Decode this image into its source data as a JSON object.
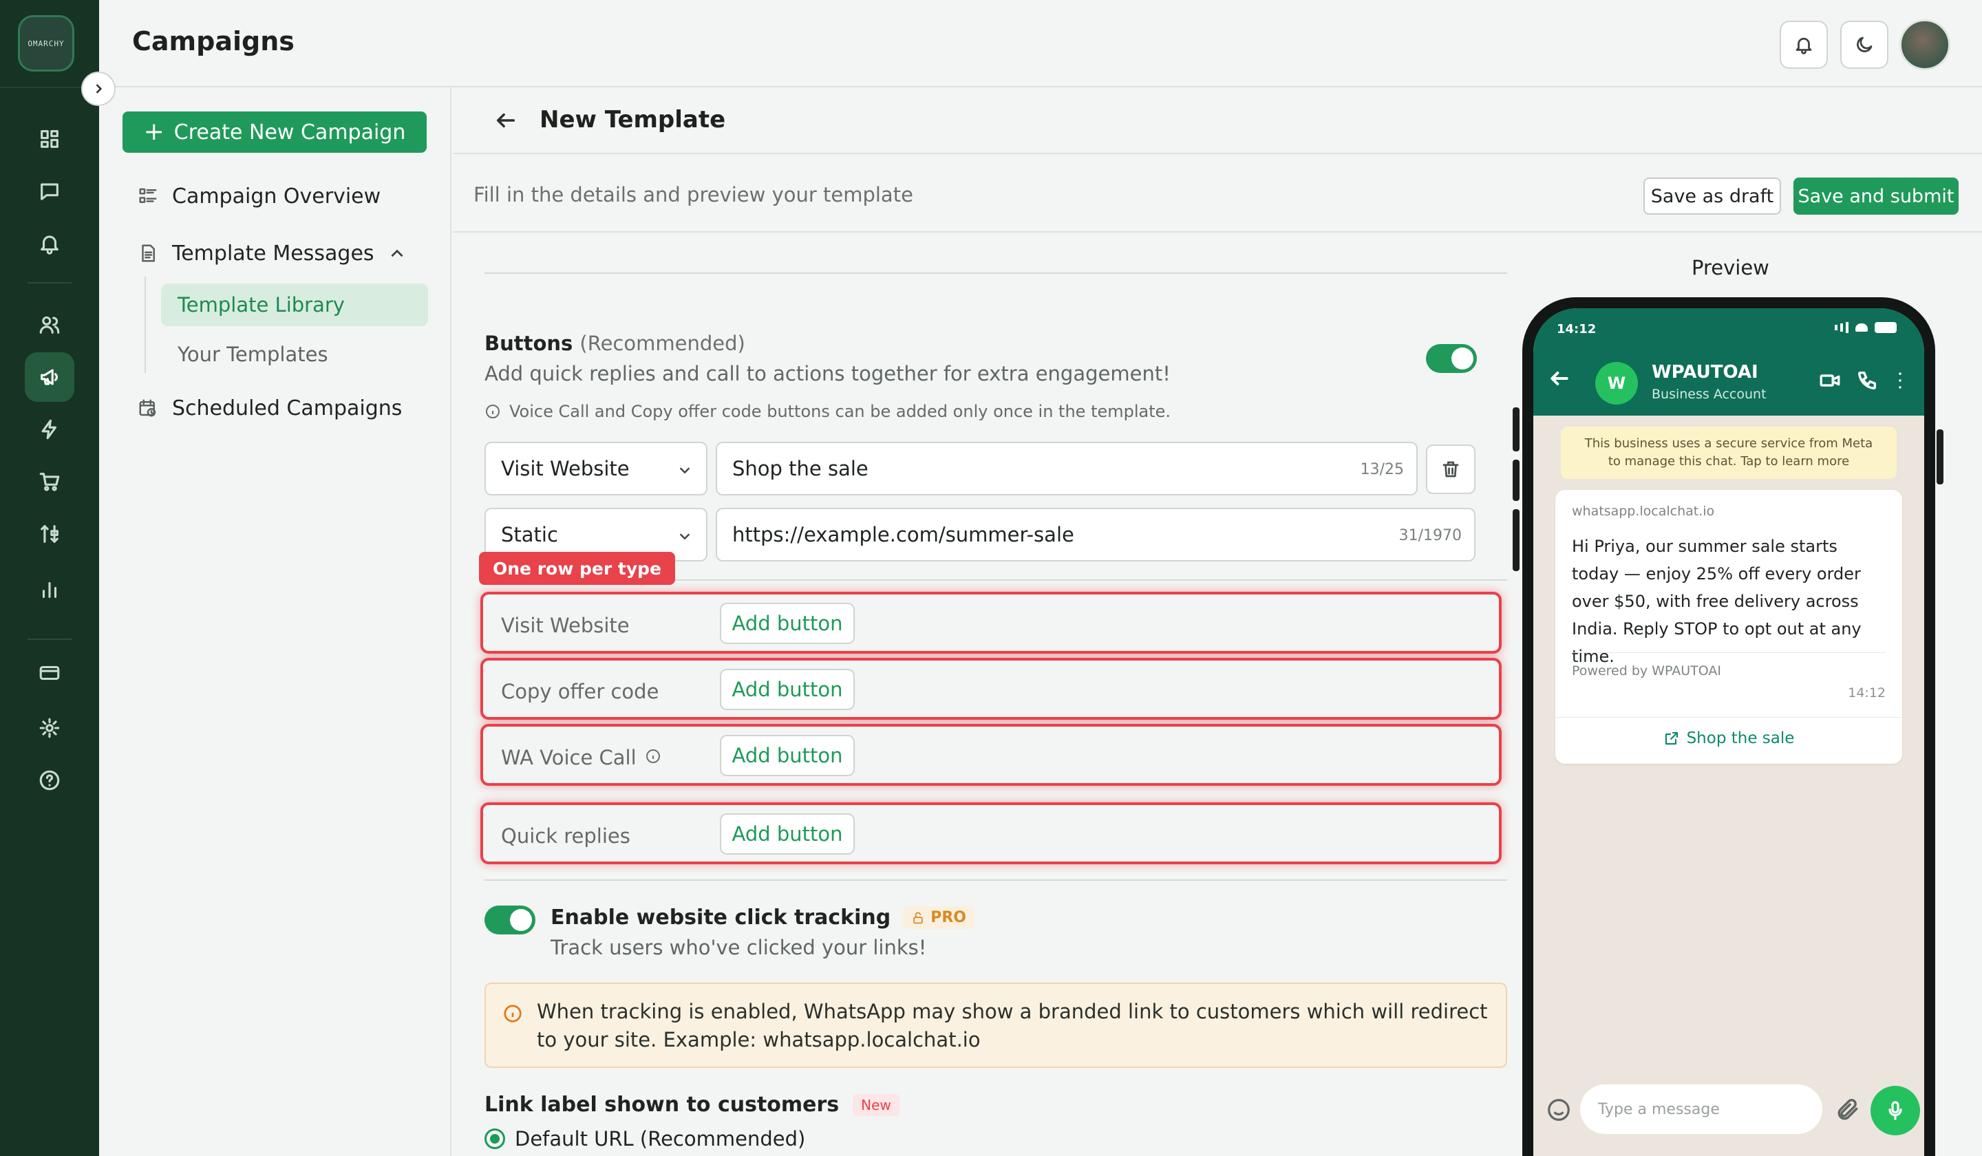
{
  "app": {
    "logo_text": "OMARCHY",
    "page_title": "Campaigns"
  },
  "nav": {
    "create_label": "Create New Campaign",
    "items": [
      {
        "label": "Campaign Overview"
      },
      {
        "label": "Template Messages"
      },
      {
        "label": "Scheduled Campaigns"
      }
    ],
    "sub_items": [
      {
        "label": "Template Library",
        "active": true
      },
      {
        "label": "Your Templates",
        "active": false
      }
    ]
  },
  "rail_icons": [
    "dashboard-icon",
    "chat-icon",
    "bell-icon",
    "users-icon",
    "megaphone-icon",
    "bolt-icon",
    "cart-icon",
    "flow-icon",
    "bar-chart-icon",
    "card-icon",
    "gear-icon",
    "help-icon"
  ],
  "editor": {
    "title": "New Template",
    "description": "Fill in the details and preview your template",
    "save_draft": "Save as draft",
    "save_submit": "Save and submit",
    "buttons_section": {
      "label": "Buttons",
      "label_suffix": "(Recommended)",
      "helper": "Add quick replies and call to actions together for extra engagement!",
      "note": "Voice Call and Copy offer code buttons can be added only once in the template.",
      "enabled": true,
      "row1": {
        "type": "Visit Website",
        "text": "Shop the sale",
        "count": "13/25"
      },
      "row2": {
        "type": "Static",
        "text": "https://example.com/summer-sale",
        "count": "31/1970"
      },
      "annotation": "One row per type",
      "add_rows": [
        {
          "label": "Visit Website",
          "button": "Add button"
        },
        {
          "label": "Copy offer code",
          "button": "Add button"
        },
        {
          "label": "WA Voice Call",
          "button": "Add button"
        },
        {
          "label": "Quick replies",
          "button": "Add button"
        }
      ]
    },
    "tracking": {
      "title": "Enable website click tracking",
      "badge": "PRO",
      "helper": "Track users who've clicked your links!",
      "enabled": true,
      "warning": "When tracking is enabled, WhatsApp may show a branded link to customers which will redirect to your site. Example: whatsapp.localchat.io"
    },
    "link_label": {
      "title": "Link label shown to customers",
      "badge": "New",
      "option_selected": "Default URL (Recommended)"
    }
  },
  "preview": {
    "label": "Preview",
    "status_time": "14:12",
    "business_name": "WPAUTOAI",
    "business_sub": "Business Account",
    "avatar_letter": "W",
    "meta_note_line1": "This business uses a secure service from Meta",
    "meta_note_line2": "to manage this chat. Tap to learn more",
    "url": "whatsapp.localchat.io",
    "message": "Hi Priya, our summer sale starts today — enjoy 25% off every order over $50, with free delivery across India. Reply STOP to opt out at any time.",
    "powered": "Powered by WPAUTOAI",
    "time": "14:12",
    "cta": "Shop the sale",
    "input_placeholder": "Type a message"
  },
  "colors": {
    "primary": "#1f9a5a",
    "rail": "#173323",
    "annotation": "#e8424a",
    "wa_header": "#0f6e57"
  }
}
